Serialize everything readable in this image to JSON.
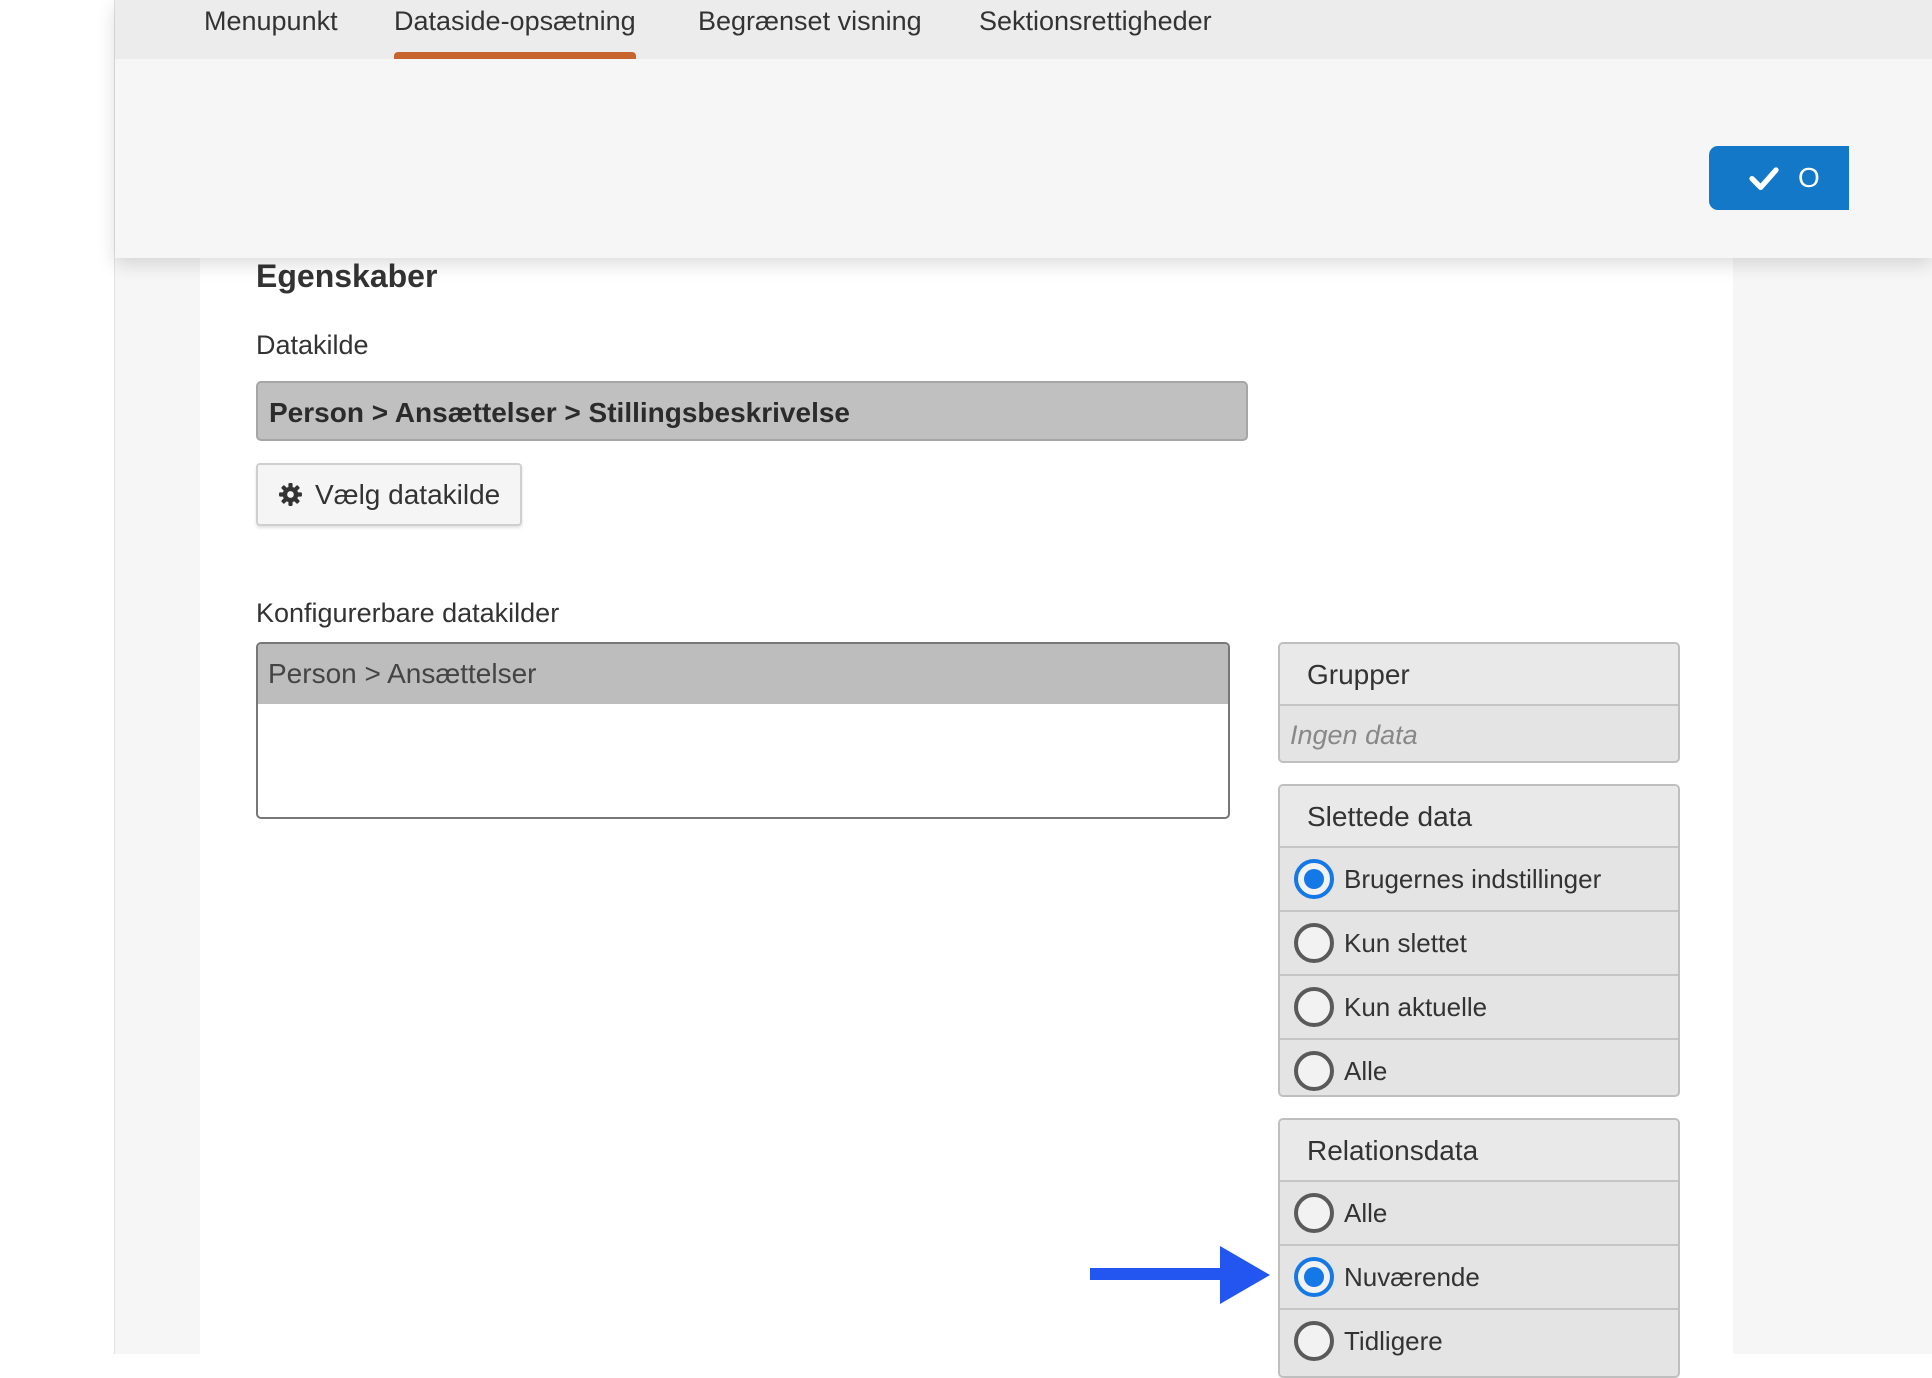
{
  "tabs": [
    {
      "label": "Menupunkt",
      "active": false
    },
    {
      "label": "Dataside-opsætning",
      "active": true
    },
    {
      "label": "Begrænset visning",
      "active": false
    },
    {
      "label": "Sektionsrettigheder",
      "active": false
    }
  ],
  "toolbar": {
    "save_label": "O",
    "save_icon": "check-icon",
    "accent_color": "#1478c8"
  },
  "properties": {
    "title": "Egenskaber",
    "datasource_label": "Datakilde",
    "datasource_value": "Person > Ansættelser > Stillingsbeskrivelse",
    "choose_button": "Vælg datakilde",
    "choose_icon": "gear-icon"
  },
  "configurable": {
    "label": "Konfigurerbare datakilder",
    "items": [
      "Person > Ansættelser"
    ]
  },
  "groups_panel": {
    "header": "Grupper",
    "empty_text": "Ingen data"
  },
  "deleted_panel": {
    "header": "Slettede data",
    "options": [
      "Brugernes indstillinger",
      "Kun slettet",
      "Kun aktuelle",
      "Alle"
    ],
    "selected": "Brugernes indstillinger"
  },
  "relation_panel": {
    "header": "Relationsdata",
    "options": [
      "Alle",
      "Nuværende",
      "Tidligere"
    ],
    "selected": "Nuværende"
  },
  "colors": {
    "tab_indicator": "#c7632c",
    "radio_selected": "#1478e6",
    "arrow": "#2356f0"
  }
}
